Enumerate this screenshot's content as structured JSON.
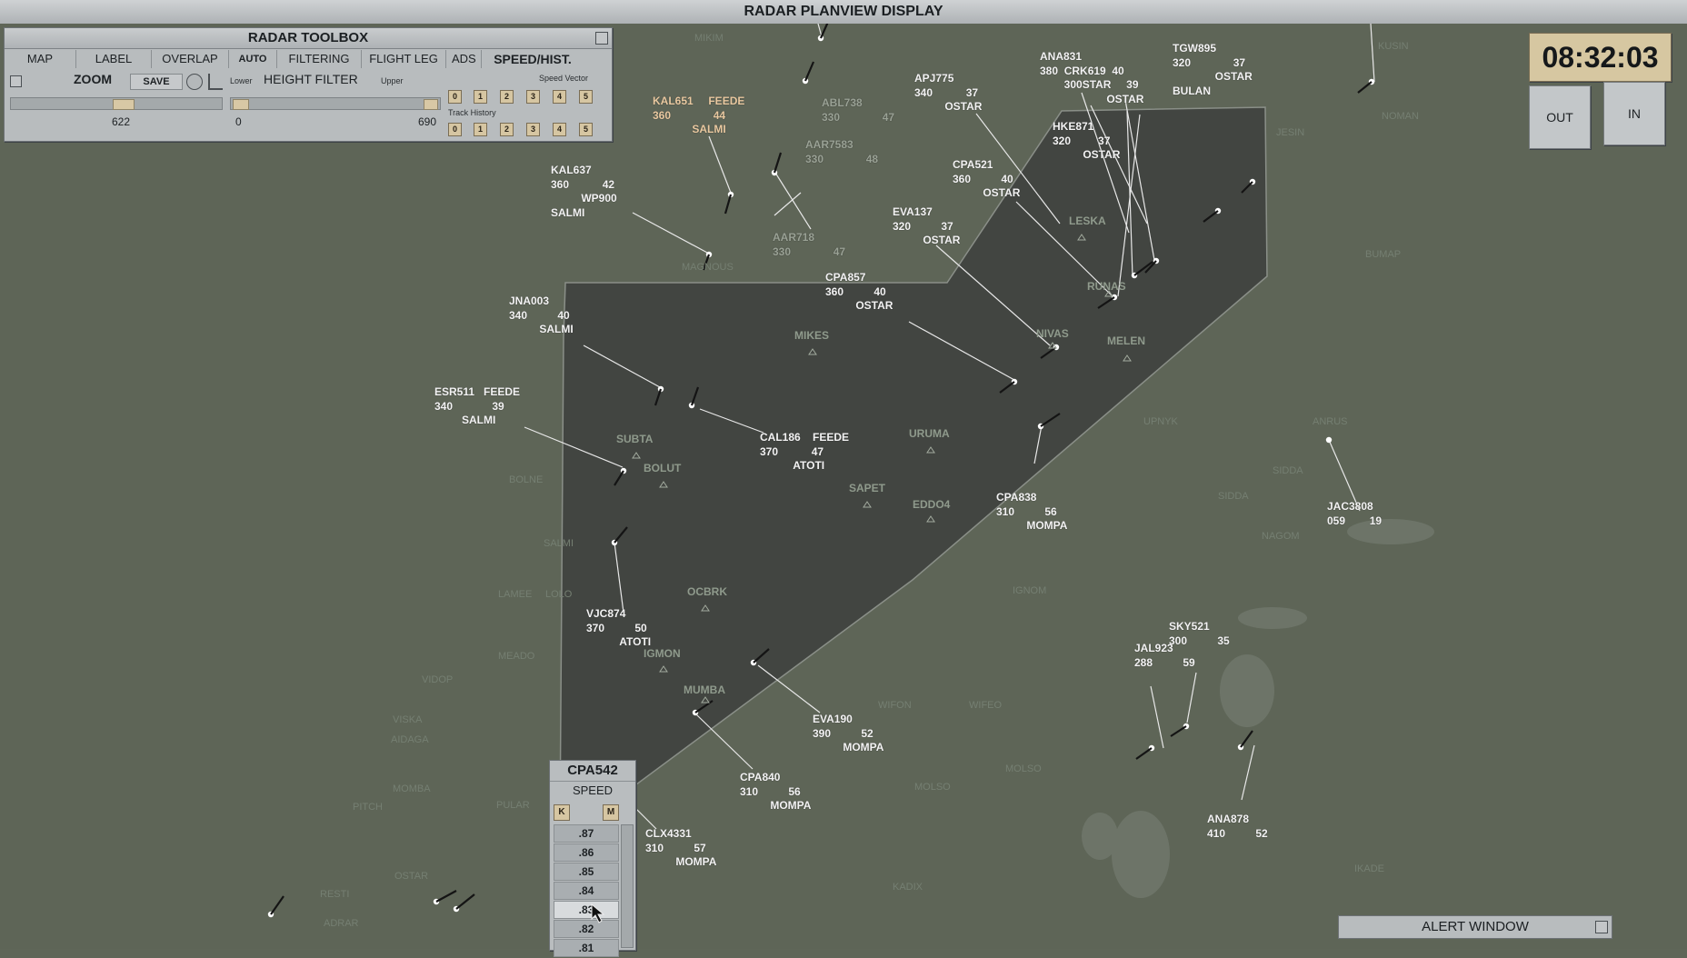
{
  "window": {
    "title": "RADAR PLANVIEW DISPLAY"
  },
  "toolbox": {
    "title": "RADAR TOOLBOX",
    "buttons": [
      "MAP",
      "LABEL",
      "OVERLAP",
      "AUTO",
      "FILTERING",
      "FLIGHT LEG",
      "ADS",
      "SPEED/HIST."
    ],
    "zoom_label": "ZOOM",
    "save_label": "SAVE",
    "zoom_value": "622",
    "height_filter_label": "HEIGHT FILTER",
    "lower_label": "Lower",
    "upper_label": "Upper",
    "height_lower": "0",
    "height_upper": "690",
    "speed_vector_label": "Speed Vector",
    "track_history_label": "Track History",
    "speed_vector_options": [
      "0",
      "1",
      "2",
      "3",
      "4",
      "5"
    ],
    "track_history_options": [
      "0",
      "1",
      "2",
      "3",
      "4",
      "5"
    ]
  },
  "clock": {
    "time": "08:32:03"
  },
  "zoom_buttons": {
    "out": "OUT",
    "in": "IN"
  },
  "speed_popup": {
    "callsign": "CPA542",
    "title": "SPEED",
    "k_label": "K",
    "m_label": "M",
    "options": [
      ".87",
      ".86",
      ".85",
      ".84",
      ".83",
      ".82",
      ".81"
    ],
    "selected": ".83"
  },
  "alert_window": {
    "title": "ALERT WINDOW"
  },
  "flights": [
    {
      "id": "KAL651",
      "text": "KAL651     FEEDE\n360              44\n             SALMI"
    },
    {
      "id": "ABL738",
      "text": "ABL738\n330              47"
    },
    {
      "id": "AAR7583",
      "text": "AAR7583\n330              48"
    },
    {
      "id": "KAL637",
      "text": "KAL637\n360           42\n          WP900\nSALMI"
    },
    {
      "id": "AAR718",
      "text": "AAR718\n330              47"
    },
    {
      "id": "APJ775",
      "text": "APJ775\n340           37\n          OSTAR"
    },
    {
      "id": "ANA831",
      "text": "ANA831\n380  CRK619  40\n        300STAR     39\n                      OSTAR"
    },
    {
      "id": "TGW895",
      "text": "TGW895\n320              37\n              OSTAR\nBULAN"
    },
    {
      "id": "HKE871",
      "text": "HKE871\n320         37\n          OSTAR"
    },
    {
      "id": "CPA521",
      "text": "CPA521\n360          40\n          OSTAR"
    },
    {
      "id": "EVA137",
      "text": "EVA137\n320          37\n          OSTAR"
    },
    {
      "id": "CPA857",
      "text": "CPA857\n360          40\n          OSTAR"
    },
    {
      "id": "JNA003",
      "text": "JNA003\n340          40\n          SALMI"
    },
    {
      "id": "ESR511",
      "text": "ESR511   FEEDE\n340             39\n         SALMI"
    },
    {
      "id": "CAL186",
      "text": "CAL186    FEEDE\n370           47\n           ATOTI"
    },
    {
      "id": "CPA838",
      "text": "CPA838\n310          56\n          MOMPA"
    },
    {
      "id": "JAC3808",
      "text": "JAC3808\n059        19"
    },
    {
      "id": "VJC874",
      "text": "VJC874\n370          50\n           ATOTI"
    },
    {
      "id": "SKY521",
      "text": "SKY521\n300          35"
    },
    {
      "id": "JAL923",
      "text": "JAL923\n288          59"
    },
    {
      "id": "EVA190",
      "text": "EVA190\n390          52\n          MOMPA"
    },
    {
      "id": "CPA840",
      "text": "CPA840\n310          56\n          MOMPA"
    },
    {
      "id": "ANA878",
      "text": "ANA878\n410          52"
    },
    {
      "id": "CLX4331",
      "text": "CLX4331\n310          57\n          MOMPA"
    }
  ],
  "waypoints": [
    "LESKA",
    "RUNAS",
    "MIKES",
    "MELEN",
    "NIVAS",
    "SUBTA",
    "BOLUT",
    "URUMA",
    "SAPET",
    "EDDO4",
    "OCBRK",
    "IGMON",
    "MUMBA"
  ]
}
